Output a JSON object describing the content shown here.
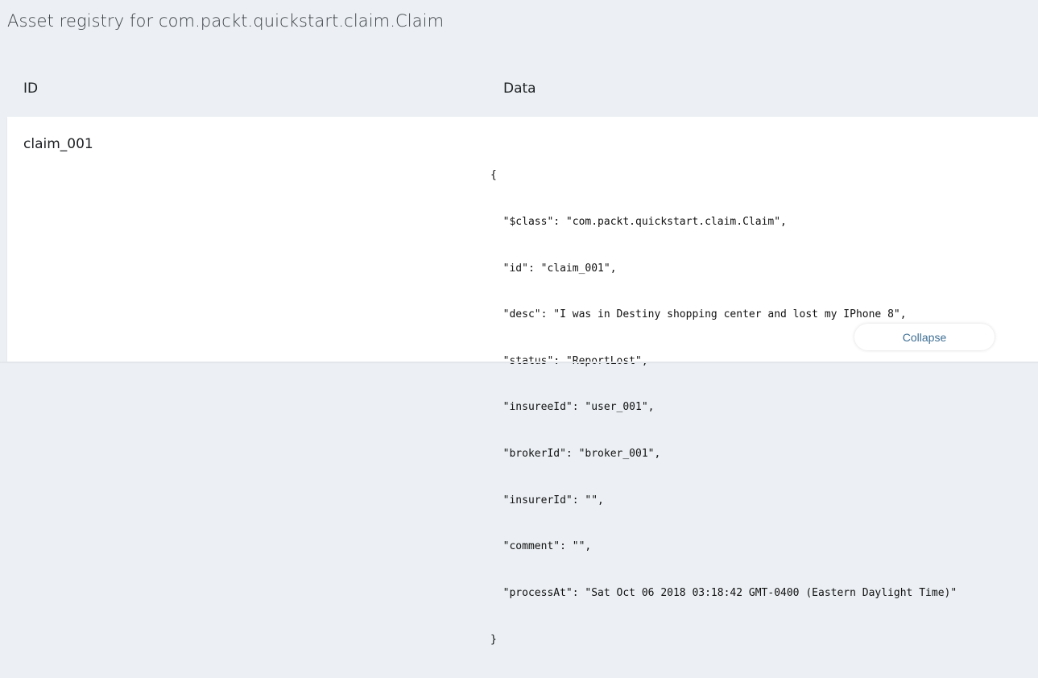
{
  "header": {
    "title": "Asset registry for com.packt.quickstart.claim.Claim"
  },
  "table": {
    "columns": {
      "id": "ID",
      "data": "Data"
    },
    "rows": [
      {
        "id": "claim_001",
        "data_lines": [
          "{",
          "  \"$class\": \"com.packt.quickstart.claim.Claim\",",
          "  \"id\": \"claim_001\",",
          "  \"desc\": \"I was in Destiny shopping center and lost my IPhone 8\",",
          "  \"status\": \"ReportLost\",",
          "  \"insureeId\": \"user_001\",",
          "  \"brokerId\": \"broker_001\",",
          "  \"insurerId\": \"\",",
          "  \"comment\": \"\",",
          "  \"processAt\": \"Sat Oct 06 2018 03:18:42 GMT-0400 (Eastern Daylight Time)\"",
          "}"
        ],
        "collapse_label": "Collapse"
      }
    ]
  },
  "colors": {
    "background": "#ecf0f4",
    "card": "#ffffff",
    "accent_text": "#3f6f94"
  }
}
